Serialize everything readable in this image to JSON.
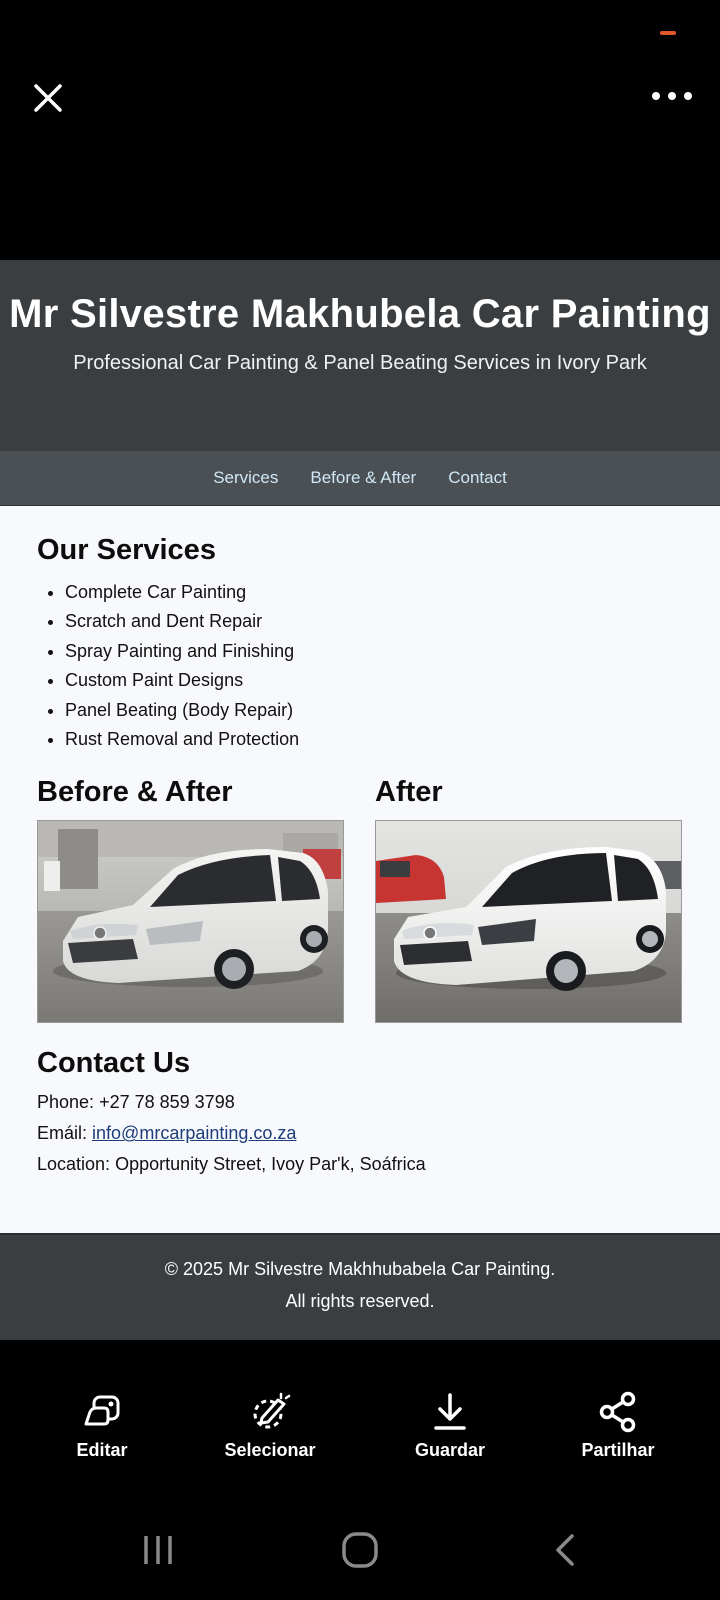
{
  "viewer": {
    "close_icon": "close-icon",
    "more_icon": "more-options-icon",
    "status_color": "#e2582a"
  },
  "site": {
    "title": "Mr Silvestre Makhubela Car Painting",
    "tagline": "Professional Car Painting & Panel Beating Services in Ivory Park",
    "nav": [
      "Services",
      "Before & After",
      "Contact"
    ],
    "services": {
      "heading": "Our Services",
      "items": [
        "Complete Car Painting",
        "Scratch and Dent Repair",
        "Spray Painting and Finishing",
        "Custom Paint Designs",
        "Panel Beating (Body Repair)",
        "Rust Removal and Protection"
      ]
    },
    "before_after": {
      "heading_left": "Before & After",
      "heading_right": "After"
    },
    "contact": {
      "heading": "Contact Us",
      "phone_label": "Phone:",
      "phone": "+27 78 859 3798",
      "email_label": "Emáil:",
      "email": "info@mrcarpainting.co.za",
      "location_label": "Location:",
      "location": "Opportunity Street, Ivoy Par'k, Soáfrica"
    },
    "footer": {
      "line1": "© 2025 Mr Silvestre Makhhubabela Car Painting.",
      "line2": "All rights reserved."
    },
    "colors": {
      "header_bg": "#3a3e41",
      "nav_bg": "#4a5054",
      "nav_link": "#cfe7f6",
      "body_bg": "#f8f9fc",
      "link": "#1d3d7a"
    }
  },
  "actions": [
    {
      "label": "Editar",
      "icon": "edit-icon"
    },
    {
      "label": "Selecionar",
      "icon": "select-icon"
    },
    {
      "label": "Guardar",
      "icon": "download-icon"
    },
    {
      "label": "Partilhar",
      "icon": "share-icon"
    }
  ],
  "system_nav": {
    "recents_icon": "recents-icon",
    "home_icon": "home-icon",
    "back_icon": "back-icon"
  }
}
